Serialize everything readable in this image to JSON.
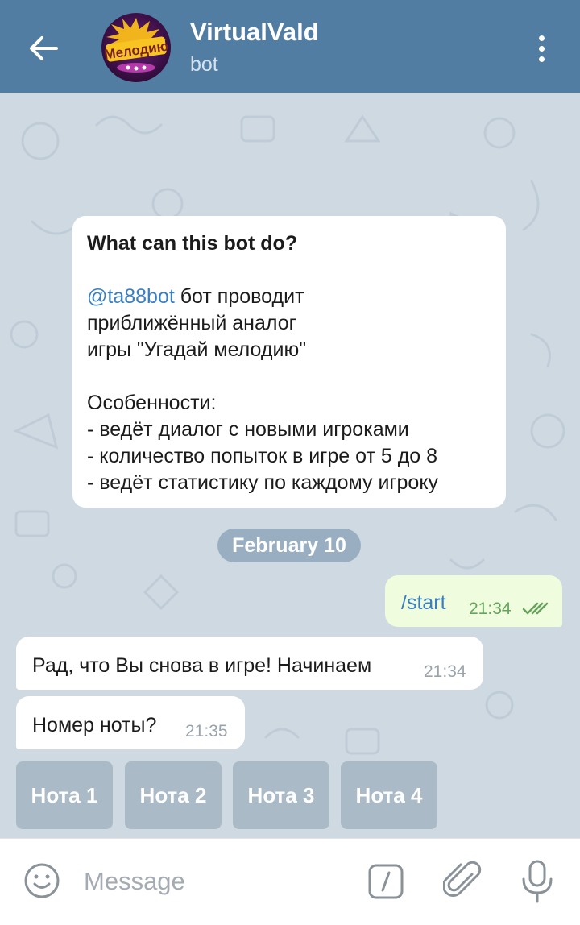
{
  "header": {
    "title": "VirtualVald",
    "subtitle": "bot",
    "avatar_text": "Мелодию",
    "back_icon": "arrow-left-icon",
    "menu_icon": "more-vertical-icon"
  },
  "intro": {
    "heading": "What can this bot do?",
    "mention": "@ta88bot",
    "line1_rest": " бот проводит",
    "line2": "приближённый аналог",
    "line3": "игры \"Угадай мелодию\"",
    "features_title": "Особенности:",
    "feature1": "- ведёт диалог с новыми игроками",
    "feature2": "- количество попыток в игре от 5 до 8",
    "feature3": "- ведёт статистику по каждому игроку"
  },
  "date_divider": "February 10",
  "messages": [
    {
      "direction": "out",
      "text": "/start",
      "time": "21:34",
      "status": "read"
    },
    {
      "direction": "in",
      "text": "Рад, что Вы снова в игре! Начинаем",
      "time": "21:34"
    },
    {
      "direction": "in",
      "text": "Номер ноты?",
      "time": "21:35"
    }
  ],
  "keyboard": {
    "buttons": [
      "Нота 1",
      "Нота 2",
      "Нота 3",
      "Нота 4"
    ]
  },
  "input_bar": {
    "placeholder": "Message",
    "emoji_icon": "smile-icon",
    "command_icon": "slash-command-icon",
    "attach_icon": "paperclip-icon",
    "mic_icon": "microphone-icon"
  },
  "colors": {
    "header_bg": "#527da3",
    "chat_bg": "#cfd9e2",
    "out_bubble": "#effdde",
    "link": "#3a7fc0",
    "read_ticks": "#65a35c"
  }
}
